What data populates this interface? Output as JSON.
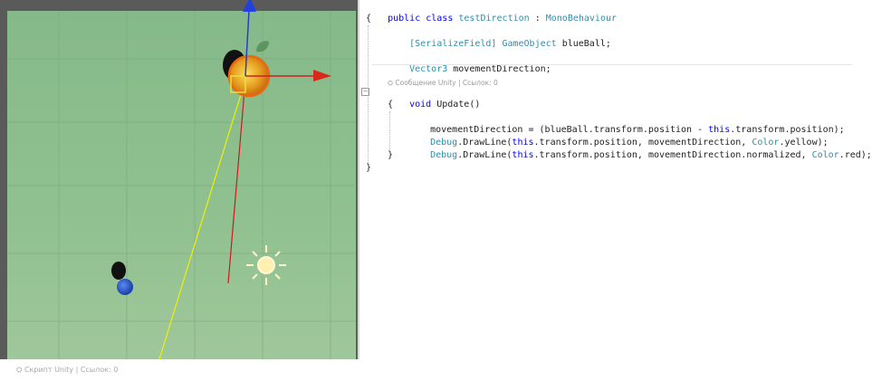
{
  "scene_view": {
    "colors": {
      "ground": "#8fc08f",
      "yellow_line": "#f0f000",
      "red_line": "#cc1a1a",
      "orange_ball": "#f0a020",
      "blue_ball": "#2a55c8"
    },
    "footer_hint": "⛭ Скрипт Unity | Ссылок: 0"
  },
  "code_editor": {
    "line1": {
      "kw1": "public",
      "kw2": "class",
      "classname": "testDirection",
      "sep": " : ",
      "base": "MonoBehaviour"
    },
    "open_brace": "{",
    "line3": {
      "attr": "[SerializeField]",
      "type": "GameObject",
      "name": " blueBall;"
    },
    "line5": {
      "type": "Vector3",
      "name": " movementDirection;"
    },
    "codelens": "⛭ Сообщение Unity | Ссылок: 0",
    "line7": {
      "kw": "void",
      "name": " Update()"
    },
    "method_open": "{",
    "line9": {
      "a": "movementDirection = (blueBall.transform.position - ",
      "kw": "this",
      "b": ".transform.position);"
    },
    "line10": {
      "type": "Debug",
      "a": ".DrawLine(",
      "kw": "this",
      "b": ".transform.position, movementDirection, ",
      "type2": "Color",
      "c": ".yellow);"
    },
    "line11": {
      "type": "Debug",
      "a": ".DrawLine(",
      "kw": "this",
      "b": ".transform.position, movementDirection.normalized, ",
      "type2": "Color",
      "c": ".red);"
    },
    "method_close": "}",
    "class_close": "}"
  }
}
